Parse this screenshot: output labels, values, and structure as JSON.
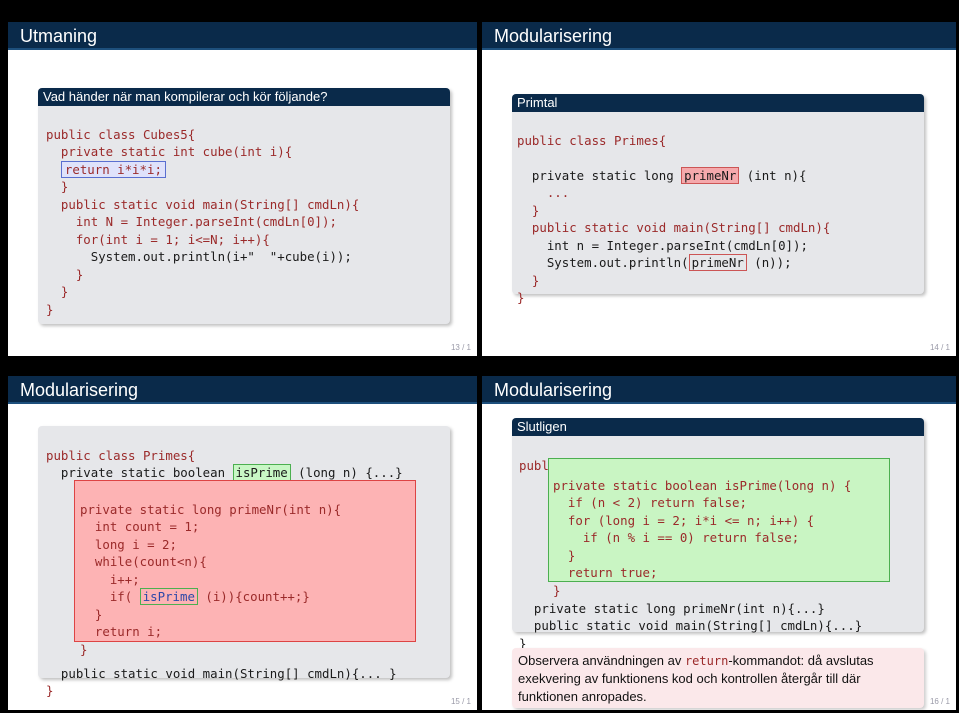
{
  "slide1": {
    "title": "Utmaning",
    "block_title": "Vad händer när man kompilerar och kör följande?",
    "lines": [
      "public class Cubes5{",
      "  private static int cube(int i){",
      "    return i*i*i;",
      "  }",
      "  public static void main(String[] cmdLn){",
      "    int N = Integer.parseInt(cmdLn[0]);",
      "    for(int i = 1; i<=N; i++){",
      "      System.out.println(i+\"  \"+cube(i));",
      "    }",
      "  }",
      "}"
    ],
    "page": "13 / 1"
  },
  "slide2": {
    "title": "Modularisering",
    "block_title": "Primtal",
    "lines": [
      "public class Primes{",
      "",
      "  private static long ",
      "primeNr",
      " (int n){",
      "    ...",
      "  }",
      "  public static void main(String[] cmdLn){",
      "    int n = Integer.parseInt(cmdLn[0]);",
      "    System.out.println(",
      " (n));",
      "  }",
      "}"
    ],
    "page": "14 / 1"
  },
  "slide3": {
    "title": "Modularisering",
    "lines": [
      "public class Primes{",
      "  private static boolean ",
      "isPrime",
      " (long n) {...}",
      "private static long primeNr(int n){",
      "  int count = 1;",
      "  long i = 2;",
      "  while(count<n){",
      "    i++;",
      "    if( ",
      " (i)){count++;}",
      "  }",
      "  return i;",
      "}",
      "  public static void main(String[] cmdLn){... }",
      "}"
    ],
    "page": "15 / 1"
  },
  "slide4": {
    "title": "Modularisering",
    "block_title": "Slutligen",
    "lines": [
      "public class Primes{",
      "private static boolean isPrime(long n) {",
      "  if (n < 2) return false;",
      "  for (long i = 2; i*i <= n; i++) {",
      "    if (n % i == 0) return false;",
      "  }",
      "  return true;",
      "}",
      "  private static long primeNr(int n){...}",
      "  public static void main(String[] cmdLn){...}",
      "}"
    ],
    "note_pre": "Observera användningen av ",
    "note_kw": "return",
    "note_post": "-kommandot: då avslutas exekvering av funktionens kod och kontrollen återgår till där funktionen anropades.",
    "page": "16 / 1"
  },
  "highlighted": {
    "primeNr": "primeNr",
    "isPrime": "isPrime"
  },
  "colors": {
    "header": "#0a2a4a",
    "block": "#e6e7ea",
    "keyword": "#9b2a2a",
    "red_highlight": "#fdb3b4",
    "green_highlight": "#c9f5c3"
  }
}
